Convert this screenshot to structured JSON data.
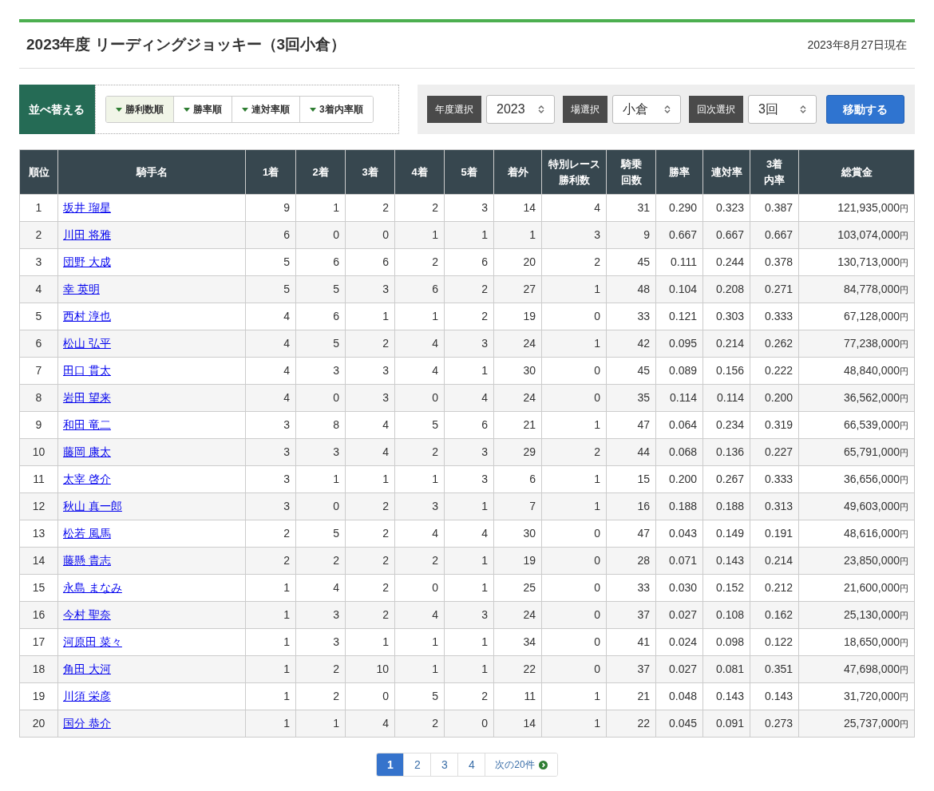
{
  "title": "2023年度 リーディングジョッキー（3回小倉）",
  "as_of": "2023年8月27日現在",
  "sort": {
    "label": "並べ替える",
    "options": [
      {
        "label": "勝利数順",
        "selected": true
      },
      {
        "label": "勝率順",
        "selected": false
      },
      {
        "label": "連対率順",
        "selected": false
      },
      {
        "label": "3着内率順",
        "selected": false
      }
    ]
  },
  "filters": [
    {
      "label": "年度選択",
      "value": "2023"
    },
    {
      "label": "場選択",
      "value": "小倉"
    },
    {
      "label": "回次選択",
      "value": "3回"
    }
  ],
  "go_button": "移動する",
  "table": {
    "columns": [
      "順位",
      "騎手名",
      "1着",
      "2着",
      "3着",
      "4着",
      "5着",
      "着外",
      "特別レース勝利数",
      "騎乗回数",
      "勝率",
      "連対率",
      "3着内率",
      "総賞金"
    ],
    "rows": [
      {
        "cells": [
          "1",
          "坂井 瑠星",
          "9",
          "1",
          "2",
          "2",
          "3",
          "14",
          "4",
          "31",
          "0.290",
          "0.323",
          "0.387",
          "121,935,000"
        ],
        "prize_unit": "円"
      },
      {
        "cells": [
          "2",
          "川田 将雅",
          "6",
          "0",
          "0",
          "1",
          "1",
          "1",
          "3",
          "9",
          "0.667",
          "0.667",
          "0.667",
          "103,074,000"
        ],
        "prize_unit": "円"
      },
      {
        "cells": [
          "3",
          "団野 大成",
          "5",
          "6",
          "6",
          "2",
          "6",
          "20",
          "2",
          "45",
          "0.111",
          "0.244",
          "0.378",
          "130,713,000"
        ],
        "prize_unit": "円"
      },
      {
        "cells": [
          "4",
          "幸 英明",
          "5",
          "5",
          "3",
          "6",
          "2",
          "27",
          "1",
          "48",
          "0.104",
          "0.208",
          "0.271",
          "84,778,000"
        ],
        "prize_unit": "円"
      },
      {
        "cells": [
          "5",
          "西村 淳也",
          "4",
          "6",
          "1",
          "1",
          "2",
          "19",
          "0",
          "33",
          "0.121",
          "0.303",
          "0.333",
          "67,128,000"
        ],
        "prize_unit": "円"
      },
      {
        "cells": [
          "6",
          "松山 弘平",
          "4",
          "5",
          "2",
          "4",
          "3",
          "24",
          "1",
          "42",
          "0.095",
          "0.214",
          "0.262",
          "77,238,000"
        ],
        "prize_unit": "円"
      },
      {
        "cells": [
          "7",
          "田口 貫太",
          "4",
          "3",
          "3",
          "4",
          "1",
          "30",
          "0",
          "45",
          "0.089",
          "0.156",
          "0.222",
          "48,840,000"
        ],
        "prize_unit": "円"
      },
      {
        "cells": [
          "8",
          "岩田 望来",
          "4",
          "0",
          "3",
          "0",
          "4",
          "24",
          "0",
          "35",
          "0.114",
          "0.114",
          "0.200",
          "36,562,000"
        ],
        "prize_unit": "円"
      },
      {
        "cells": [
          "9",
          "和田 竜二",
          "3",
          "8",
          "4",
          "5",
          "6",
          "21",
          "1",
          "47",
          "0.064",
          "0.234",
          "0.319",
          "66,539,000"
        ],
        "prize_unit": "円"
      },
      {
        "cells": [
          "10",
          "藤岡 康太",
          "3",
          "3",
          "4",
          "2",
          "3",
          "29",
          "2",
          "44",
          "0.068",
          "0.136",
          "0.227",
          "65,791,000"
        ],
        "prize_unit": "円"
      },
      {
        "cells": [
          "11",
          "太宰 啓介",
          "3",
          "1",
          "1",
          "1",
          "3",
          "6",
          "1",
          "15",
          "0.200",
          "0.267",
          "0.333",
          "36,656,000"
        ],
        "prize_unit": "円"
      },
      {
        "cells": [
          "12",
          "秋山 真一郎",
          "3",
          "0",
          "2",
          "3",
          "1",
          "7",
          "1",
          "16",
          "0.188",
          "0.188",
          "0.313",
          "49,603,000"
        ],
        "prize_unit": "円"
      },
      {
        "cells": [
          "13",
          "松若 風馬",
          "2",
          "5",
          "2",
          "4",
          "4",
          "30",
          "0",
          "47",
          "0.043",
          "0.149",
          "0.191",
          "48,616,000"
        ],
        "prize_unit": "円"
      },
      {
        "cells": [
          "14",
          "藤懸 貴志",
          "2",
          "2",
          "2",
          "2",
          "1",
          "19",
          "0",
          "28",
          "0.071",
          "0.143",
          "0.214",
          "23,850,000"
        ],
        "prize_unit": "円"
      },
      {
        "cells": [
          "15",
          "永島 まなみ",
          "1",
          "4",
          "2",
          "0",
          "1",
          "25",
          "0",
          "33",
          "0.030",
          "0.152",
          "0.212",
          "21,600,000"
        ],
        "prize_unit": "円"
      },
      {
        "cells": [
          "16",
          "今村 聖奈",
          "1",
          "3",
          "2",
          "4",
          "3",
          "24",
          "0",
          "37",
          "0.027",
          "0.108",
          "0.162",
          "25,130,000"
        ],
        "prize_unit": "円"
      },
      {
        "cells": [
          "17",
          "河原田 菜々",
          "1",
          "3",
          "1",
          "1",
          "1",
          "34",
          "0",
          "41",
          "0.024",
          "0.098",
          "0.122",
          "18,650,000"
        ],
        "prize_unit": "円"
      },
      {
        "cells": [
          "18",
          "角田 大河",
          "1",
          "2",
          "10",
          "1",
          "1",
          "22",
          "0",
          "37",
          "0.027",
          "0.081",
          "0.351",
          "47,698,000"
        ],
        "prize_unit": "円"
      },
      {
        "cells": [
          "19",
          "川須 栄彦",
          "1",
          "2",
          "0",
          "5",
          "2",
          "11",
          "1",
          "21",
          "0.048",
          "0.143",
          "0.143",
          "31,720,000"
        ],
        "prize_unit": "円"
      },
      {
        "cells": [
          "20",
          "国分 恭介",
          "1",
          "1",
          "4",
          "2",
          "0",
          "14",
          "1",
          "22",
          "0.045",
          "0.091",
          "0.273",
          "25,737,000"
        ],
        "prize_unit": "円"
      }
    ]
  },
  "pagination": {
    "pages": [
      {
        "label": "1",
        "selected": true
      },
      {
        "label": "2",
        "selected": false
      },
      {
        "label": "3",
        "selected": false
      },
      {
        "label": "4",
        "selected": false
      }
    ],
    "next": "次の20件"
  }
}
